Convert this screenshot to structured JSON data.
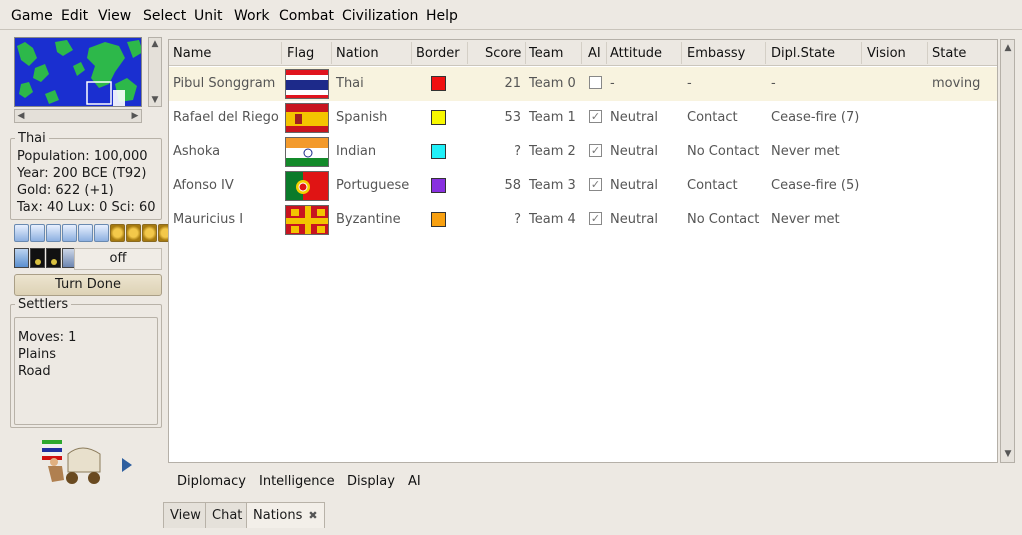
{
  "menu": [
    "Game",
    "Edit",
    "View",
    "Select",
    "Unit",
    "Work",
    "Combat",
    "Civilization",
    "Help"
  ],
  "civ_box": {
    "title": "Thai",
    "population": "Population: 100,000",
    "year": "Year: 200 BCE (T92)",
    "gold": "Gold: 622 (+1)",
    "tax": "Tax: 40 Lux: 0 Sci: 60"
  },
  "off_label": "off",
  "turn_done": "Turn Done",
  "unit_box": {
    "title": "Settlers",
    "moves": "Moves: 1",
    "terrain": "Plains",
    "road": "Road"
  },
  "table": {
    "headers": {
      "name": "Name",
      "flag": "Flag",
      "nation": "Nation",
      "border": "Border",
      "score": "Score",
      "team": "Team",
      "ai": "AI",
      "attitude": "Attitude",
      "embassy": "Embassy",
      "dipl": "Dipl.State",
      "vision": "Vision",
      "state": "State"
    },
    "rows": [
      {
        "name": "Pibul Songgram",
        "nation": "Thai",
        "border_color": "#f01010",
        "score": "21",
        "team": "Team 0",
        "ai": false,
        "attitude": "-",
        "embassy": "-",
        "dipl": "-",
        "vision": "",
        "state": "moving"
      },
      {
        "name": "Rafael del Riego",
        "nation": "Spanish",
        "border_color": "#f8f800",
        "score": "53",
        "team": "Team 1",
        "ai": true,
        "attitude": "Neutral",
        "embassy": "Contact",
        "dipl": "Cease-fire (7)",
        "vision": "",
        "state": ""
      },
      {
        "name": "Ashoka",
        "nation": "Indian",
        "border_color": "#20f0f8",
        "score": "?",
        "team": "Team 2",
        "ai": true,
        "attitude": "Neutral",
        "embassy": "No Contact",
        "dipl": "Never met",
        "vision": "",
        "state": ""
      },
      {
        "name": "Afonso IV",
        "nation": "Portuguese",
        "border_color": "#8830e0",
        "score": "58",
        "team": "Team 3",
        "ai": true,
        "attitude": "Neutral",
        "embassy": "Contact",
        "dipl": "Cease-fire (5)",
        "vision": "",
        "state": ""
      },
      {
        "name": "Mauricius I",
        "nation": "Byzantine",
        "border_color": "#f8a010",
        "score": "?",
        "team": "Team 4",
        "ai": true,
        "attitude": "Neutral",
        "embassy": "No Contact",
        "dipl": "Never met",
        "vision": "",
        "state": ""
      }
    ]
  },
  "bottom_buttons": [
    "Diplomacy",
    "Intelligence",
    "Display",
    "AI"
  ],
  "tabs": [
    "View",
    "Chat",
    "Nations"
  ]
}
